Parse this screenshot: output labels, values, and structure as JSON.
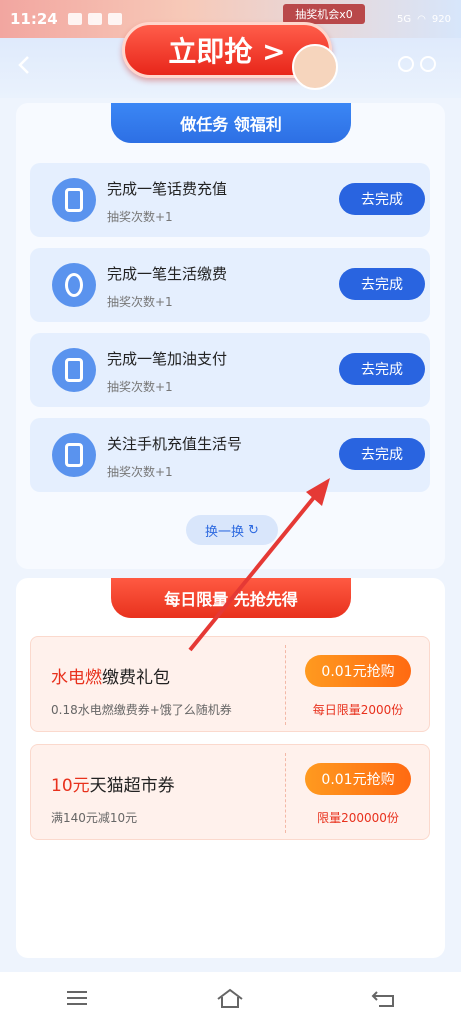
{
  "status_bar": {
    "time": "11:24",
    "chance_label": "抽奖机会x0",
    "network": "5G",
    "battery": "920"
  },
  "header": {
    "grab_button": "立即抢 >"
  },
  "tasks": {
    "banner": "做任务 领福利",
    "items": [
      {
        "title": "完成一笔话费充值",
        "sub": "抽奖次数+1",
        "button": "去完成",
        "icon": "phone-recharge-icon"
      },
      {
        "title": "完成一笔生活缴费",
        "sub": "抽奖次数+1",
        "button": "去完成",
        "icon": "utility-drop-icon"
      },
      {
        "title": "完成一笔加油支付",
        "sub": "抽奖次数+1",
        "button": "去完成",
        "icon": "fuel-pump-icon"
      },
      {
        "title": "关注手机充值生活号",
        "sub": "抽奖次数+1",
        "button": "去完成",
        "icon": "phone-follow-icon"
      }
    ],
    "refresh": "换一换"
  },
  "limited": {
    "banner": "每日限量 先抢先得",
    "offers": [
      {
        "title_hl": "水电燃",
        "title": "缴费礼包",
        "desc": "0.18水电燃缴费券+饿了么随机券",
        "button": "0.01元抢购",
        "limit": "每日限量2000份"
      },
      {
        "title_hl": "10元",
        "title": "天猫超市券",
        "desc": "满140元减10元",
        "button": "0.01元抢购",
        "limit": "限量200000份"
      }
    ]
  },
  "colors": {
    "primary_blue": "#2964e0",
    "accent_red": "#e8311d",
    "accent_orange": "#ff7a14"
  }
}
